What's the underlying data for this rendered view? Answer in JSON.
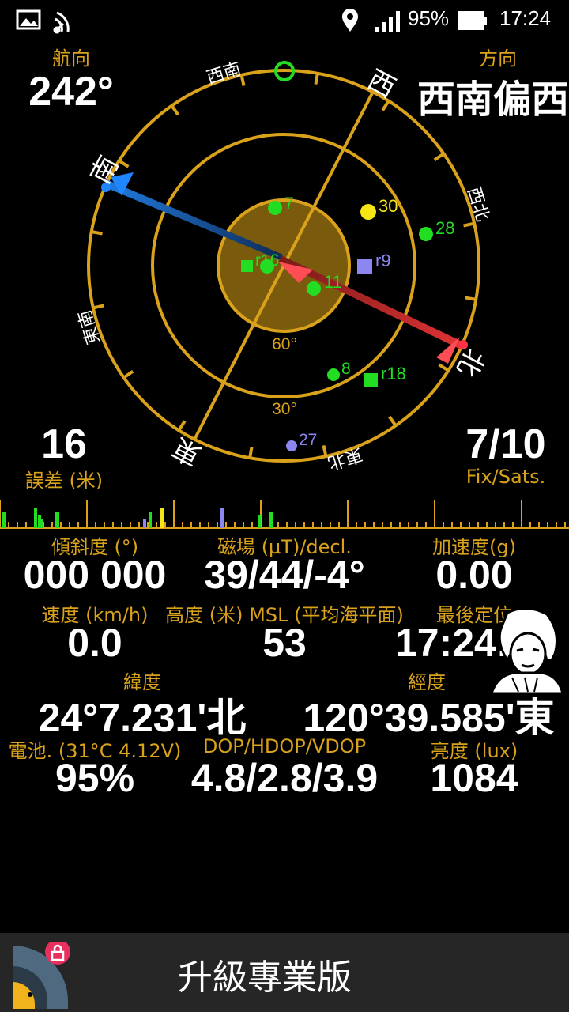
{
  "status_bar": {
    "battery_percent": "95%",
    "time": "17:24",
    "icons": [
      "image-icon",
      "nfc-icon",
      "location-pin-icon",
      "signal-icon",
      "battery-icon"
    ]
  },
  "heading": {
    "label": "航向",
    "value": "242°"
  },
  "direction": {
    "label": "方向",
    "value": "西南偏西"
  },
  "error": {
    "value": "16",
    "label": "誤差 (米)"
  },
  "fix": {
    "value": "7/10",
    "label": "Fix/Sats."
  },
  "compass": {
    "cardinals": {
      "north": "北",
      "south": "南",
      "east": "東",
      "west": "西"
    },
    "intercardinals": {
      "sw": "西南",
      "nw": "西北",
      "se": "東南",
      "ne": "東北"
    },
    "elevation_labels": [
      "60°",
      "30°"
    ],
    "satellites": [
      {
        "id": "7",
        "color": "#22dd22",
        "shape": "circle"
      },
      {
        "id": "30",
        "color": "#f5e514",
        "shape": "circle"
      },
      {
        "id": "28",
        "color": "#22dd22",
        "shape": "circle"
      },
      {
        "id": "r9",
        "color": "#8b86f0",
        "shape": "square"
      },
      {
        "id": "r16",
        "color": "#22dd22",
        "shape": "square"
      },
      {
        "id": "11",
        "color": "#22dd22",
        "shape": "circle"
      },
      {
        "id": "8",
        "color": "#22dd22",
        "shape": "circle"
      },
      {
        "id": "r18",
        "color": "#22dd22",
        "shape": "square"
      },
      {
        "id": "27",
        "color": "#8b86f0",
        "shape": "circle"
      }
    ]
  },
  "metrics": {
    "tilt": {
      "label": "傾斜度 (°)",
      "value": "000 000"
    },
    "magnetic": {
      "label": "磁場 (µT)/decl.",
      "value": "39/44/-4°"
    },
    "accel": {
      "label": "加速度(g)",
      "value": "0.00"
    },
    "speed": {
      "label": "速度 (km/h)",
      "value": "0.0"
    },
    "altitude": {
      "label": "高度 (米) MSL (平均海平面)",
      "value": "53"
    },
    "last_fix": {
      "label": "最後定位",
      "value": "17:24:18"
    },
    "latitude": {
      "label": "緯度",
      "value": "24°7.231'北"
    },
    "longitude": {
      "label": "經度",
      "value": "120°39.585'東"
    },
    "battery": {
      "label": "電池. (31°C 4.12V)",
      "value": "95%"
    },
    "dop": {
      "label": "DOP/HDOP/VDOP",
      "value": "4.8/2.8/3.9"
    },
    "brightness": {
      "label": "亮度 (lux)",
      "value": "1084"
    }
  },
  "bottom": {
    "upgrade_label": "升級專業版"
  },
  "colors": {
    "accent": "#d9a21a",
    "satellite_used": "#22dd22"
  }
}
